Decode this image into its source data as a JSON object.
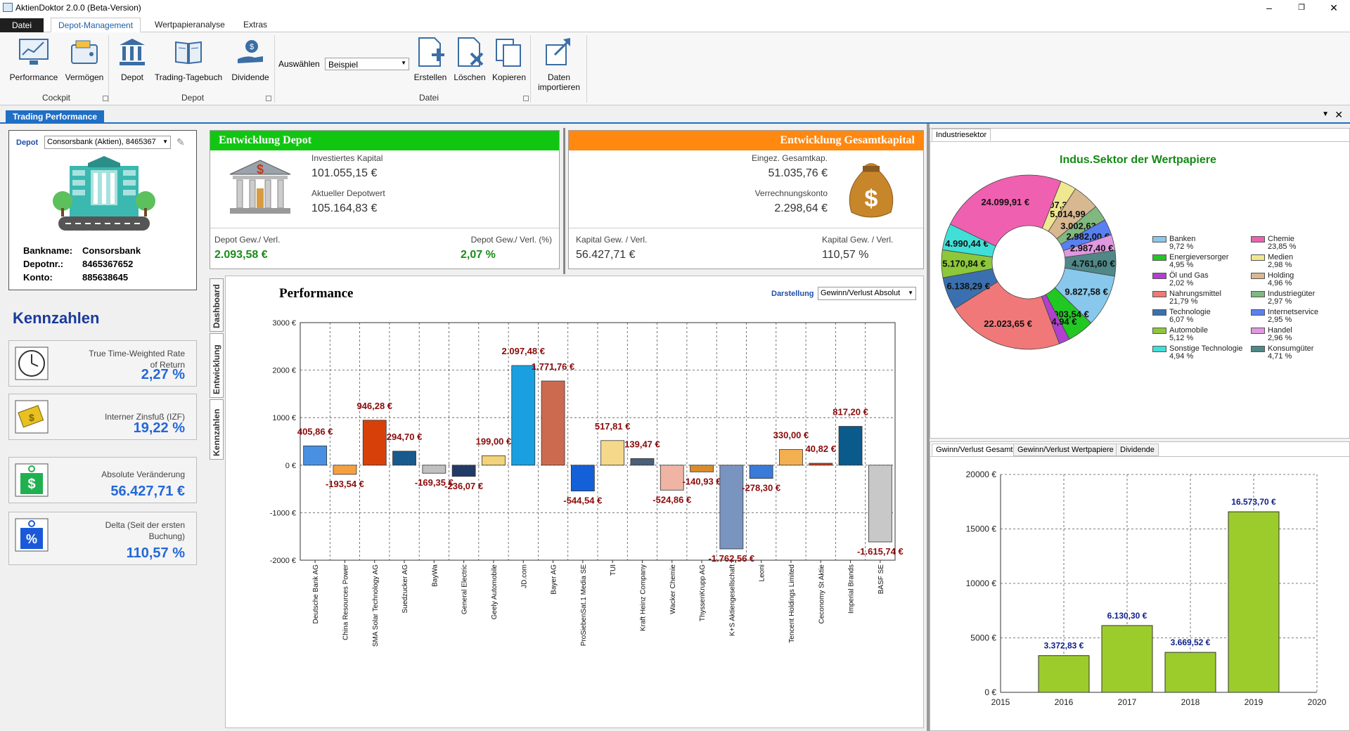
{
  "window": {
    "title": "AktienDoktor 2.0.0 (Beta-Version)"
  },
  "ribbon": {
    "tabs": [
      "Datei",
      "Depot-Management",
      "Wertpapieranalyse",
      "Extras"
    ],
    "buttons": {
      "performance": "Performance",
      "vermoegen": "Vermögen",
      "depot": "Depot",
      "trading": "Trading-Tagebuch",
      "dividende": "Dividende",
      "erstellen": "Erstellen",
      "loeschen": "Löschen",
      "kopieren": "Kopieren",
      "daten1": "Daten",
      "daten2": "importieren"
    },
    "groups": {
      "cockpit": "Cockpit",
      "depot": "Depot",
      "datei": "Datei"
    },
    "auswaehlen_label": "Auswählen",
    "auswaehlen_value": "Beispiel"
  },
  "doc_tab": "Trading Performance",
  "depot_panel": {
    "label": "Depot",
    "selected": "Consorsbank (Aktien), 8465367",
    "bankname_label": "Bankname:",
    "bankname": "Consorsbank",
    "depotnr_label": "Depotnr.:",
    "depotnr": "8465367652",
    "konto_label": "Konto:",
    "konto": "885638645"
  },
  "kennzahlen": {
    "title": "Kennzahlen",
    "items": [
      {
        "label": "True Time-Weighted Rate of Return",
        "value": "2,27 %",
        "icon": "clock-icon"
      },
      {
        "label": "Interner Zinsfuß (IZF)",
        "value": "19,22 %",
        "icon": "money-icon"
      },
      {
        "label": "Absolute Veränderung",
        "value": "56.427,71 €",
        "icon": "dollar-tag-icon"
      },
      {
        "label": "Delta (Seit der ersten Buchung)",
        "value": "110,57 %",
        "icon": "percent-tag-icon"
      }
    ]
  },
  "entwicklung_depot": {
    "title": "Entwicklung Depot",
    "investiert_label": "Investiertes Kapital",
    "investiert": "101.055,15 €",
    "aktuell_label": "Aktueller Depotwert",
    "aktuell": "105.164,83 €",
    "gv_label": "Depot Gew./ Verl.",
    "gv": "2.093,58 €",
    "gvp_label": "Depot Gew./ Verl. (%)",
    "gvp": "2,07 %"
  },
  "entwicklung_gesamt": {
    "title": "Entwicklung Gesamtkapital",
    "eingez_label": "Eingez. Gesamtkap.",
    "eingez": "51.035,76 €",
    "verr_label": "Verrechnungskonto",
    "verr": "2.298,64 €",
    "kgv_label": "Kapital Gew. / Verl.",
    "kgv": "56.427,71 €",
    "kgvp_label": "Kapital Gew. / Verl.",
    "kgvp": "110,57 %"
  },
  "side_tabs": [
    "Dashboard",
    "Entwicklung",
    "Kennzahlen"
  ],
  "performance": {
    "title": "Performance",
    "darstellung_label": "Darstellung",
    "darstellung_value": "Gewinn/Verlust Absolut"
  },
  "industrie": {
    "tab": "Industriesektor",
    "title": "Indus.Sektor der Wertpapiere"
  },
  "bottom_tabs": [
    "Gwinn/Verlust Gesamt",
    "Gewinn/Verlust Wertpapiere",
    "Dividende"
  ],
  "chart_data": [
    {
      "type": "bar",
      "title": "Performance",
      "ylim": [
        -2000,
        3000
      ],
      "yticks": [
        "3000 €",
        "2000 €",
        "1000 €",
        "0 €",
        "-1000 €",
        "-2000 €"
      ],
      "categories": [
        "Deutsche Bank AG",
        "China Resources Power",
        "SMA Solar Technology AG",
        "Suedzucker AG",
        "BayWa",
        "General Electric",
        "Geely Automobile",
        "JD.com",
        "Bayer AG",
        "ProSiebenSat.1 Media SE",
        "TUI",
        "Kraft Heinz Company",
        "Wacker Chemie",
        "ThyssenKrupp AG",
        "K+S Aktiengesellschaft",
        "Leoni",
        "Tencent Holdings Limited",
        "Ceconomy St Aktie",
        "Imperial Brands",
        "BASF SE"
      ],
      "values": [
        405.86,
        -193.54,
        946.28,
        294.7,
        -169.35,
        -236.07,
        199.0,
        2097.48,
        1771.76,
        -544.54,
        517.81,
        139.47,
        -524.86,
        -140.93,
        -1762.56,
        -278.3,
        330.0,
        40.82,
        817.2,
        -1615.74
      ],
      "labels": [
        "405,86 €",
        "-193,54 €",
        "946,28 €",
        "294,70 €",
        "-169,35 €",
        "-236,07 €",
        "199,00 €",
        "2.097,48 €",
        "1.771,76 €",
        "-544,54 €",
        "517,81 €",
        "139,47 €",
        "-524,86 €",
        "-140,93 €",
        "-1.762,56 €",
        "-278,30 €",
        "330,00 €",
        "40,82 €",
        "817,20 €",
        "-1.615,74 €"
      ],
      "colors": [
        "#4a90e2",
        "#f5a040",
        "#d8400a",
        "#185a8c",
        "#c0c0c0",
        "#223a66",
        "#f2d27a",
        "#1aa0e0",
        "#cc6a50",
        "#1460d8",
        "#f5d88a",
        "#4a5f7a",
        "#f0b4a4",
        "#d98c2a",
        "#7a94c0",
        "#3a7ad8",
        "#f2b050",
        "#c84020",
        "#0a5a8c",
        "#c8c8c8"
      ]
    },
    {
      "type": "pie",
      "title": "Indus.Sektor der Wertpapiere",
      "slices": [
        {
          "name": "Banken",
          "pct": "9,72 %",
          "value": 9827.58,
          "label": "9.827,58 €",
          "color": "#88c8ec"
        },
        {
          "name": "Energieversorger",
          "pct": "4,95 %",
          "value": 5003.54,
          "label": "5.003,54 €",
          "color": "#22c822"
        },
        {
          "name": "Öl und Gas",
          "pct": "2,02 %",
          "value": 2044.94,
          "label": "2.044,94 €",
          "color": "#b040d0"
        },
        {
          "name": "Nahrungsmittel",
          "pct": "21,79 %",
          "value": 22023.65,
          "label": "22.023,65 €",
          "color": "#f07878"
        },
        {
          "name": "Technologie",
          "pct": "6,07 %",
          "value": 6138.29,
          "label": "6.138,29 €",
          "color": "#3a70b0"
        },
        {
          "name": "Automobile",
          "pct": "5,12 %",
          "value": 5170.84,
          "label": "5.170,84 €",
          "color": "#8cc83a"
        },
        {
          "name": "Sonstige Technologie",
          "pct": "4,94 %",
          "value": 4990.44,
          "label": "4.990,44 €",
          "color": "#40e0d8"
        },
        {
          "name": "Chemie",
          "pct": "23,85 %",
          "value": 24099.91,
          "label": "24.099,91 €",
          "color": "#f060b0"
        },
        {
          "name": "Medien",
          "pct": "2,98 %",
          "value": 3007.34,
          "label": "3.007,34 €",
          "color": "#f0e890"
        },
        {
          "name": "Holding",
          "pct": "4,96 %",
          "value": 5014.99,
          "label": "5.014,99 €",
          "color": "#d8b890"
        },
        {
          "name": "Industriegüter",
          "pct": "2,97 %",
          "value": 3002.63,
          "label": "3.002,63 €",
          "color": "#80b880"
        },
        {
          "name": "Internetservice",
          "pct": "2,95 %",
          "value": 2982.0,
          "label": "2.982,00 €",
          "color": "#5880f0"
        },
        {
          "name": "Handel",
          "pct": "2,96 %",
          "value": 2987.4,
          "label": "2.987,40 €",
          "color": "#e098e0"
        },
        {
          "name": "Konsumgüter",
          "pct": "4,71 %",
          "value": 4761.6,
          "label": "4.761,60 €",
          "color": "#508888"
        }
      ]
    },
    {
      "type": "bar",
      "title": "",
      "x": [
        2016,
        2017,
        2018,
        2019
      ],
      "values": [
        3372.83,
        6130.3,
        3669.52,
        16573.7
      ],
      "labels": [
        "3.372,83 €",
        "6.130,30 €",
        "3.669,52 €",
        "16.573,70 €"
      ],
      "xlim": [
        2015,
        2020
      ],
      "xticks": [
        "2015",
        "2016",
        "2017",
        "2018",
        "2019",
        "2020"
      ],
      "ylim": [
        0,
        20000
      ],
      "yticks": [
        "20000 €",
        "15000 €",
        "10000 €",
        "5000 €",
        "0 €"
      ],
      "color": "#9ccc2c"
    }
  ]
}
